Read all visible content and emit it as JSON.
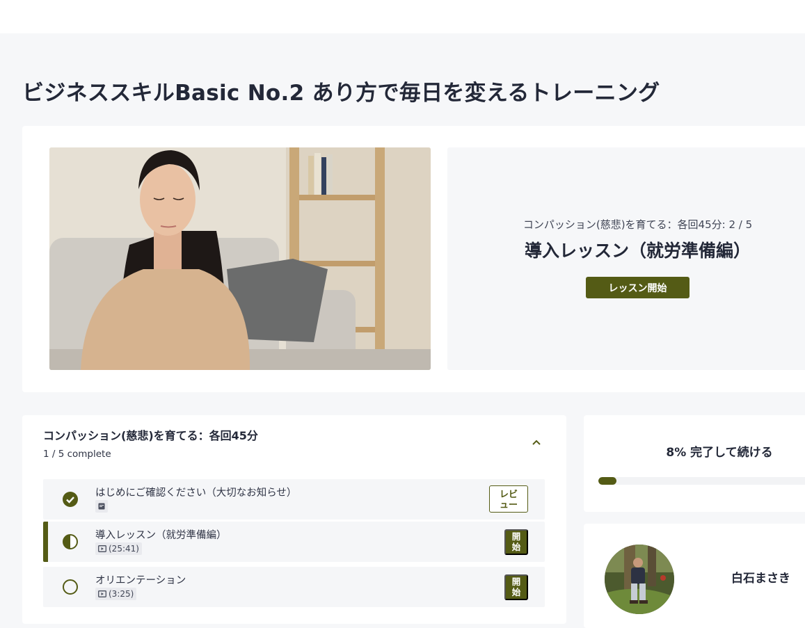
{
  "course": {
    "title": "ビジネススキルBasic No.2 あり方で毎日を変えるトレーニング"
  },
  "hero": {
    "subtitle": "コンパッション(慈悲)を育てる：各回45分: 2 / 5",
    "lesson_title": "導入レッスン（就労準備編）",
    "start_label": "レッスン開始"
  },
  "section": {
    "title": "コンパッション(慈悲)を育てる：各回45分",
    "count": "1 / 5 complete",
    "lessons": [
      {
        "label": "はじめにご確認ください（大切なお知らせ）",
        "status": "complete",
        "type": "text",
        "duration": "",
        "action": "レビュー"
      },
      {
        "label": "導入レッスン（就労準備編）",
        "status": "in-progress",
        "type": "video",
        "duration": "(25:41)",
        "action": "開始"
      },
      {
        "label": "オリエンテーション",
        "status": "not-started",
        "type": "video",
        "duration": "(3:25)",
        "action": "開始"
      }
    ]
  },
  "progress": {
    "text": "8% 完了して続ける",
    "percent": 8
  },
  "author": {
    "name": "白石まさき"
  },
  "colors": {
    "accent": "#545b15",
    "background": "#f6f7f9",
    "card": "#ffffff",
    "text": "#232838"
  }
}
